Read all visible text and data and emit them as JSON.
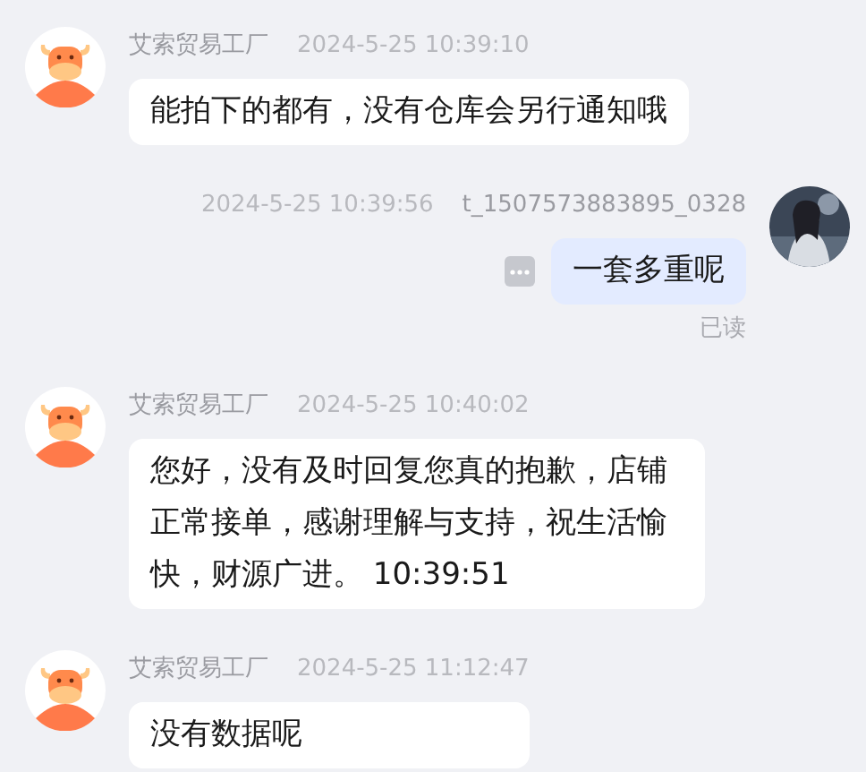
{
  "messages": [
    {
      "kind": "received",
      "sender": "艾索贸易工厂",
      "time": "2024-5-25 10:39:10",
      "text": "能拍下的都有，没有仓库会另行通知哦"
    },
    {
      "kind": "sent",
      "sender": "t_1507573883895_0328",
      "time": "2024-5-25 10:39:56",
      "text": "一套多重呢",
      "status": "已读"
    },
    {
      "kind": "received",
      "sender": "艾索贸易工厂",
      "time": "2024-5-25 10:40:02",
      "text": "您好，没有及时回复您真的抱歉，店铺正常接单，感谢理解与支持，祝生活愉快，财源广进。 10:39:51"
    },
    {
      "kind": "received",
      "sender": "艾索贸易工厂",
      "time": "2024-5-25 11:12:47",
      "text": "没有数据呢"
    }
  ]
}
